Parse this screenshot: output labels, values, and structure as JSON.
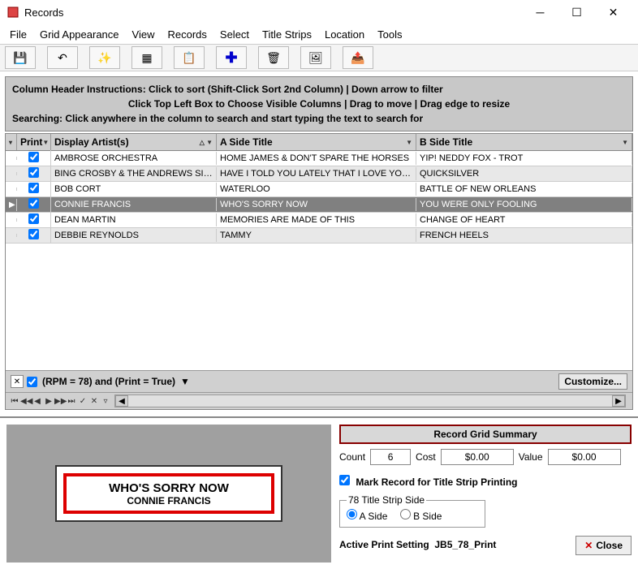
{
  "window": {
    "title": "Records"
  },
  "menu": [
    "File",
    "Grid Appearance",
    "View",
    "Records",
    "Select",
    "Title Strips",
    "Location",
    "Tools"
  ],
  "instructions": {
    "label1": "Column Header Instructions:",
    "text1": " Click to sort (Shift-Click Sort 2nd Column) | Down arrow to filter",
    "text2": "Click Top Left Box to Choose Visible Columns | Drag to move | Drag edge to resize",
    "label3": "Searching:",
    "text3": " Click anywhere in the column to search and start typing the text to search for"
  },
  "columns": {
    "print": "Print",
    "artist": "Display Artist(s)",
    "aside": "A Side Title",
    "bside": "B Side Title"
  },
  "rows": [
    {
      "print": true,
      "artist": "AMBROSE ORCHESTRA",
      "aside": "HOME JAMES & DON'T SPARE THE HORSES",
      "bside": "YIP!  NEDDY  FOX - TROT",
      "alt": false,
      "sel": false
    },
    {
      "print": true,
      "artist": "BING CROSBY & THE ANDREWS SISTE...",
      "aside": "HAVE I TOLD YOU LATELY THAT I LOVE YOU?",
      "bside": "QUICKSILVER",
      "alt": true,
      "sel": false
    },
    {
      "print": true,
      "artist": "BOB CORT",
      "aside": "WATERLOO",
      "bside": "BATTLE OF NEW ORLEANS",
      "alt": false,
      "sel": false
    },
    {
      "print": true,
      "artist": "CONNIE FRANCIS",
      "aside": "WHO'S SORRY NOW",
      "bside": "YOU WERE ONLY FOOLING",
      "alt": false,
      "sel": true
    },
    {
      "print": true,
      "artist": "DEAN MARTIN",
      "aside": "MEMORIES  ARE  MADE  OF  THIS",
      "bside": "CHANGE  OF  HEART",
      "alt": false,
      "sel": false
    },
    {
      "print": true,
      "artist": "DEBBIE REYNOLDS",
      "aside": "TAMMY",
      "bside": "FRENCH HEELS",
      "alt": true,
      "sel": false
    }
  ],
  "filter": {
    "text": "(RPM = 78) and (Print = True)",
    "customize": "Customize..."
  },
  "preview": {
    "title": "WHO'S  SORRY  NOW",
    "artist": "CONNIE FRANCIS"
  },
  "summary": {
    "header": "Record Grid Summary",
    "count_label": "Count",
    "count": "6",
    "cost_label": "Cost",
    "cost": "$0.00",
    "value_label": "Value",
    "value": "$0.00",
    "mark_label": "Mark Record for Title Strip Printing",
    "side_legend": "78 Title Strip Side",
    "side_a": "A Side",
    "side_b": "B Side",
    "active_label": "Active Print Setting",
    "active_value": "JB5_78_Print",
    "close": "Close"
  }
}
